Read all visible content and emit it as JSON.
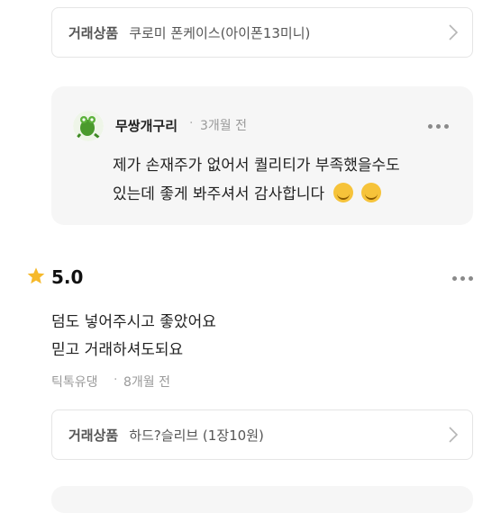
{
  "product_card_top": {
    "label": "거래상품",
    "name": "쿠로미 폰케이스(아이폰13미니)"
  },
  "seller_reply": {
    "username": "무쌍개구리",
    "time": "3개월 전",
    "line1": "제가 손재주가 없어서 퀄리티가 부족했을수도",
    "line2": "있는데 좋게 봐주셔서 감사합니다",
    "emoji_icon": "smiling-face-icon"
  },
  "review": {
    "rating": "5.0",
    "line1": "덤도 넣어주시고 좋았어요",
    "line2": "믿고 거래하셔도되요",
    "author": "틱톡유댕",
    "time": "8개월 전"
  },
  "product_card_bottom": {
    "label": "거래상품",
    "name": "하드?슬리브 (1장10원)"
  }
}
